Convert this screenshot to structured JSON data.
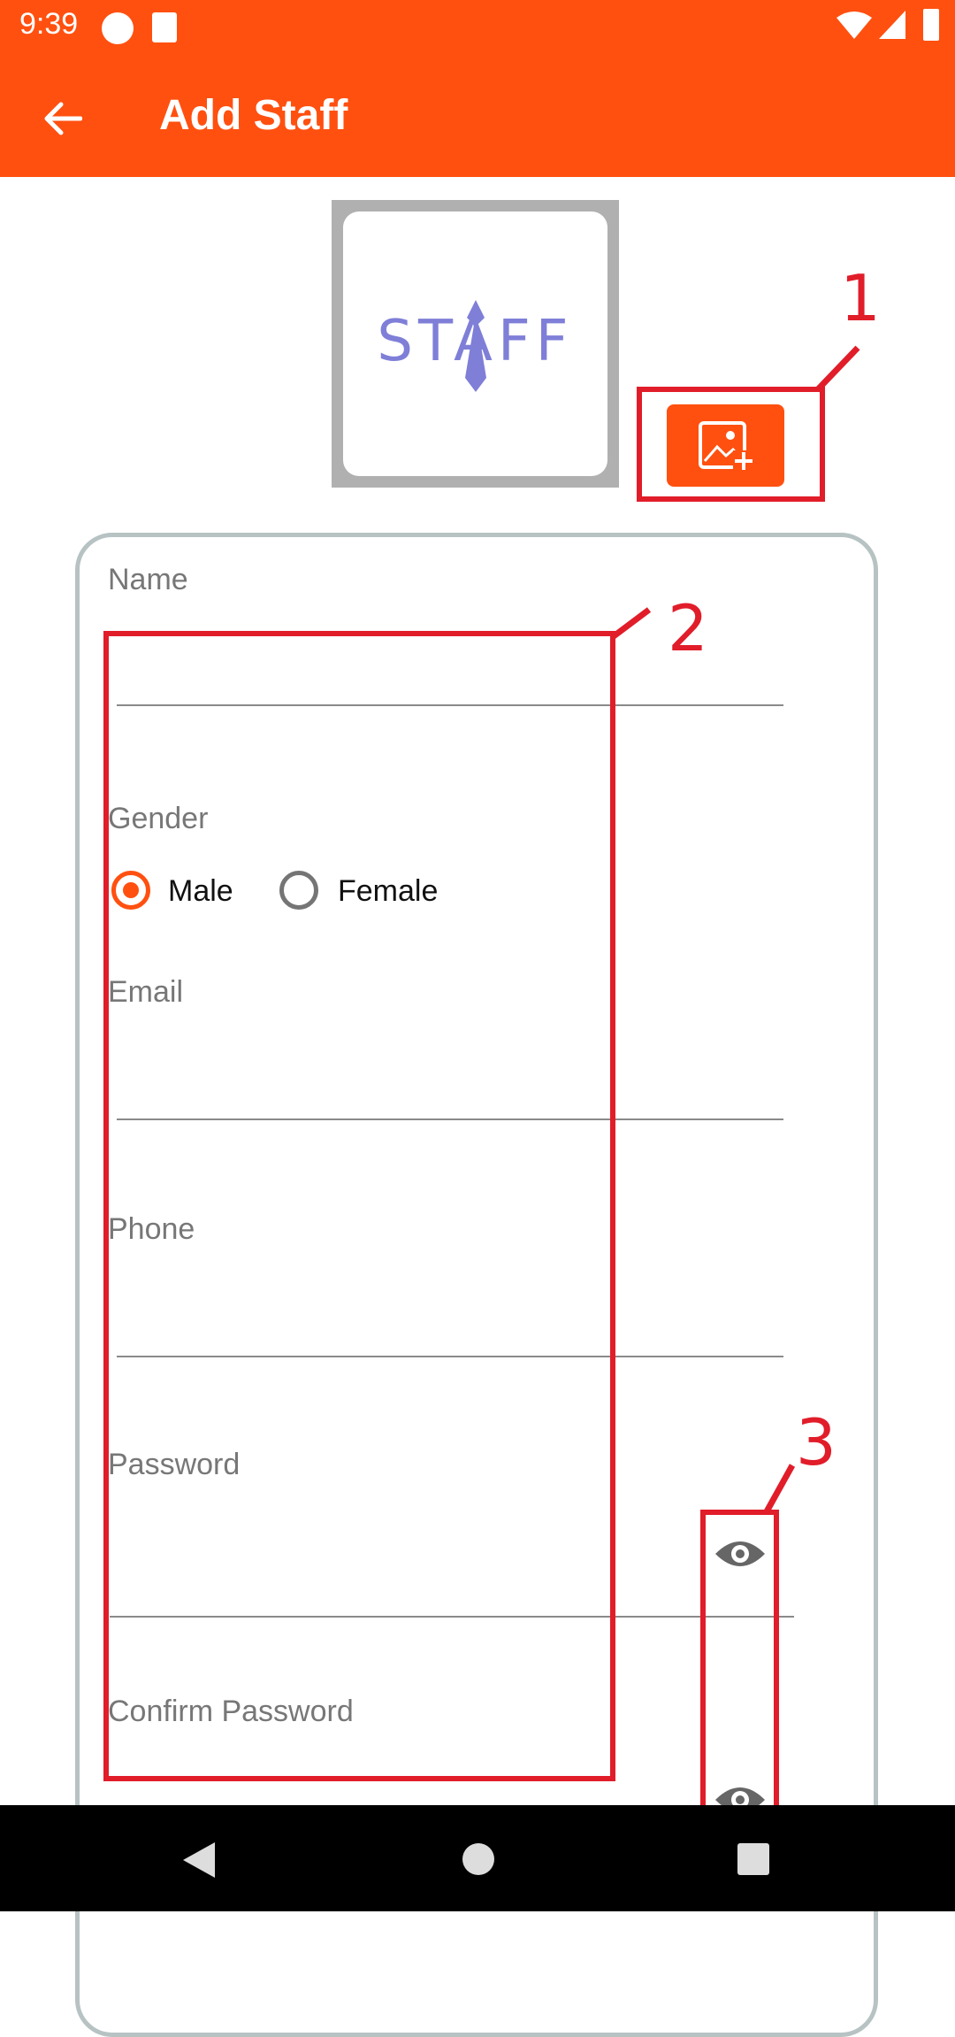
{
  "status_bar": {
    "time": "9:39"
  },
  "app_bar": {
    "title": "Add Staff"
  },
  "logo": {
    "text": "STAFF"
  },
  "form": {
    "name_label": "Name",
    "name_value": "",
    "gender_label": "Gender",
    "gender_options": [
      "Male",
      "Female"
    ],
    "gender_selected": "Male",
    "email_label": "Email",
    "email_value": "",
    "phone_label": "Phone",
    "phone_value": "",
    "password_label": "Password",
    "password_value": "",
    "confirm_password_label": "Confirm Password",
    "confirm_password_value": ""
  },
  "annotations": [
    "1",
    "2",
    "3"
  ],
  "colors": {
    "accent": "#FF5010",
    "annotation": "#e11d2a",
    "card_border": "#b7c2c3"
  }
}
